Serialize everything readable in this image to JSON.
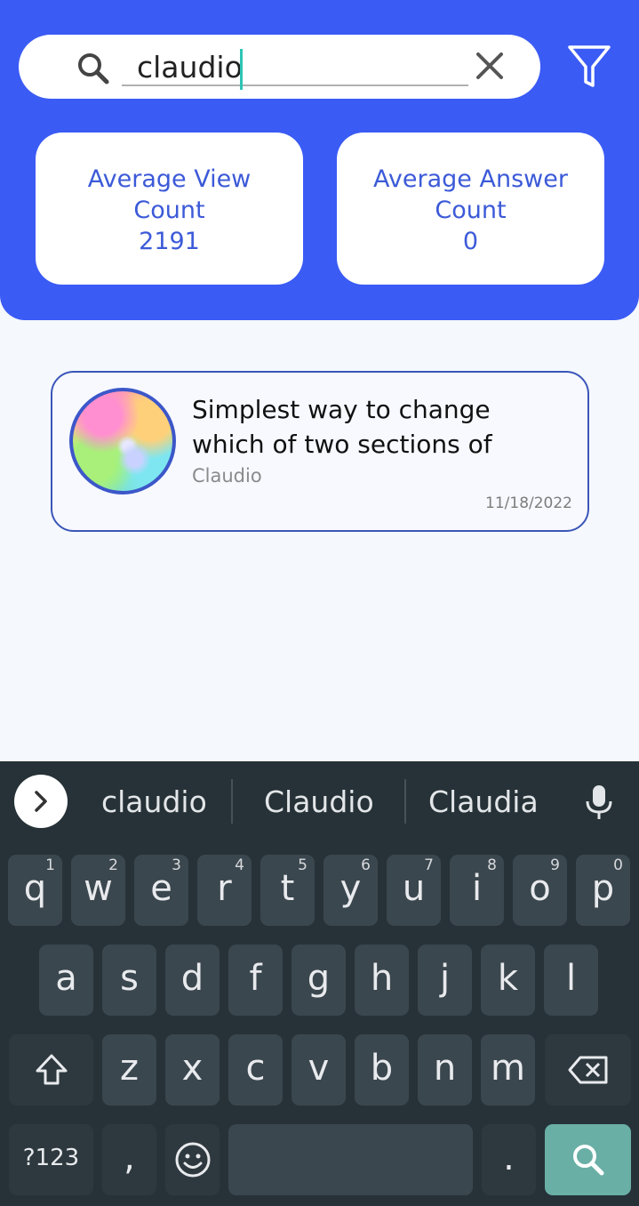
{
  "search": {
    "query": "claudio"
  },
  "stats": {
    "view": {
      "label": "Average View Count",
      "value": "2191"
    },
    "answer": {
      "label": "Average Answer Count",
      "value": "0"
    }
  },
  "result": {
    "title": "Simplest way to change which of two sections of",
    "author": "Claudio",
    "date": "11/18/2022"
  },
  "keyboard": {
    "suggestions": [
      "claudio",
      "Claudio",
      "Claudia"
    ],
    "row1": [
      {
        "key": "q",
        "hint": "1"
      },
      {
        "key": "w",
        "hint": "2"
      },
      {
        "key": "e",
        "hint": "3"
      },
      {
        "key": "r",
        "hint": "4"
      },
      {
        "key": "t",
        "hint": "5"
      },
      {
        "key": "y",
        "hint": "6"
      },
      {
        "key": "u",
        "hint": "7"
      },
      {
        "key": "i",
        "hint": "8"
      },
      {
        "key": "o",
        "hint": "9"
      },
      {
        "key": "p",
        "hint": "0"
      }
    ],
    "row2": [
      "a",
      "s",
      "d",
      "f",
      "g",
      "h",
      "j",
      "k",
      "l"
    ],
    "row3": [
      "z",
      "x",
      "c",
      "v",
      "b",
      "n",
      "m"
    ],
    "symbols_label": "?123",
    "comma": ",",
    "period": "."
  },
  "colors": {
    "header": "#3b5bf5",
    "accent_text": "#3c5ad8",
    "keyboard_bg": "#263238",
    "search_key": "#6aafa6"
  },
  "icons": [
    "search-icon",
    "close-icon",
    "filter-icon",
    "chevron-right-icon",
    "mic-icon",
    "shift-icon",
    "backspace-icon",
    "emoji-icon"
  ]
}
